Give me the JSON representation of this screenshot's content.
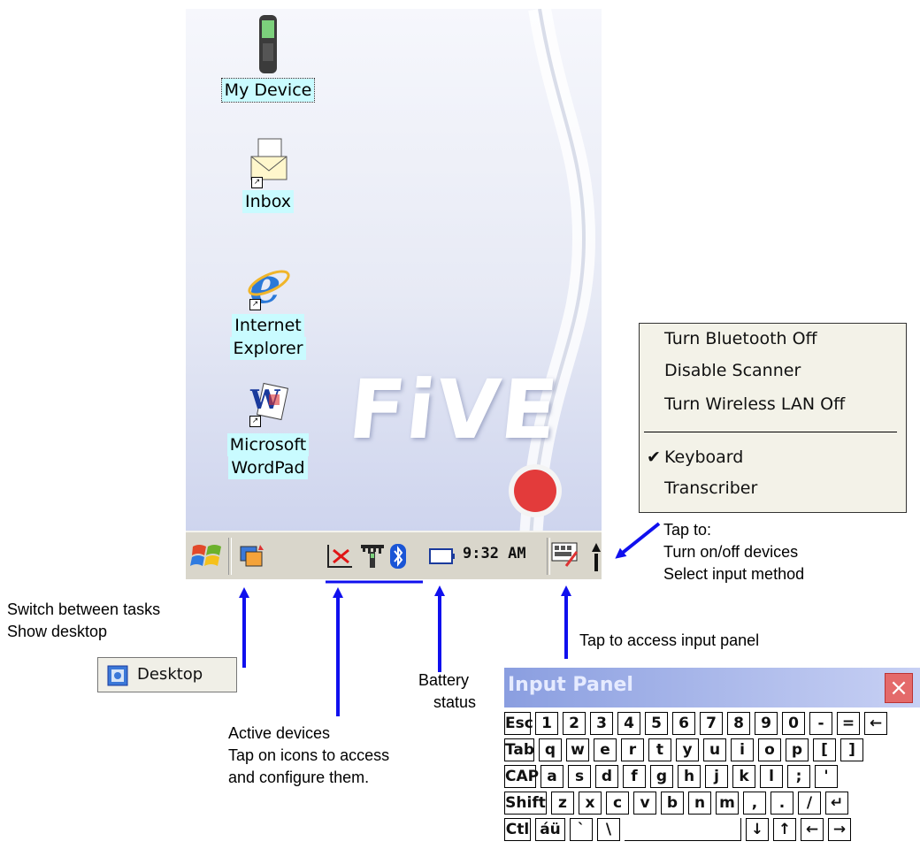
{
  "desktop_icons": [
    {
      "label": "My Device",
      "icon": "handheld-device-icon",
      "selected": true
    },
    {
      "label": "Inbox",
      "icon": "inbox-envelope-icon"
    },
    {
      "label": "Internet",
      "label2": "Explorer",
      "icon": "internet-explorer-icon"
    },
    {
      "label": "Microsoft",
      "label2": "WordPad",
      "icon": "wordpad-icon"
    }
  ],
  "wallpaper_text": "FiVE",
  "taskbar": {
    "clock": "9:32 AM",
    "icons": [
      "start-icon",
      "task-switcher-icon",
      "scanner-off-icon",
      "signal-icon",
      "bluetooth-icon",
      "battery-icon",
      "input-panel-icon",
      "devices-menu-icon"
    ]
  },
  "menu": {
    "items": [
      "Turn Bluetooth Off",
      "Disable Scanner",
      "Turn Wireless LAN Off"
    ],
    "input_methods": [
      "Keyboard",
      "Transcriber"
    ],
    "checked": "Keyboard"
  },
  "annotations": {
    "tap_to": "Tap to:",
    "turn_devices": "Turn on/off devices",
    "select_input": "Select input method",
    "switch_tasks": "Switch between tasks",
    "show_desktop": "Show desktop",
    "tap_input_panel": "Tap to access input panel",
    "battery": "Battery",
    "status": "status",
    "active_devices": "Active devices",
    "tap_icons": "Tap on icons to access",
    "configure": "and configure them."
  },
  "desktop_button": {
    "label": "Desktop"
  },
  "input_panel": {
    "title": "Input Panel",
    "close": "×",
    "rows": [
      [
        "Esc",
        "1",
        "2",
        "3",
        "4",
        "5",
        "6",
        "7",
        "8",
        "9",
        "0",
        "-",
        "=",
        "←"
      ],
      [
        "Tab",
        "q",
        "w",
        "e",
        "r",
        "t",
        "y",
        "u",
        "i",
        "o",
        "p",
        "[",
        "]"
      ],
      [
        "CAP",
        "a",
        "s",
        "d",
        "f",
        "g",
        "h",
        "j",
        "k",
        "l",
        ";",
        "'"
      ],
      [
        "Shift",
        "z",
        "x",
        "c",
        "v",
        "b",
        "n",
        "m",
        ",",
        ".",
        "/",
        "↵"
      ],
      [
        "Ctl",
        "áü",
        "`",
        "\\",
        "",
        "↓",
        "↑",
        "←",
        "→"
      ]
    ]
  },
  "colors": {
    "arrow": "#1010ee",
    "label_highlight": "#c9fbff",
    "record_button": "#e33b3b"
  }
}
